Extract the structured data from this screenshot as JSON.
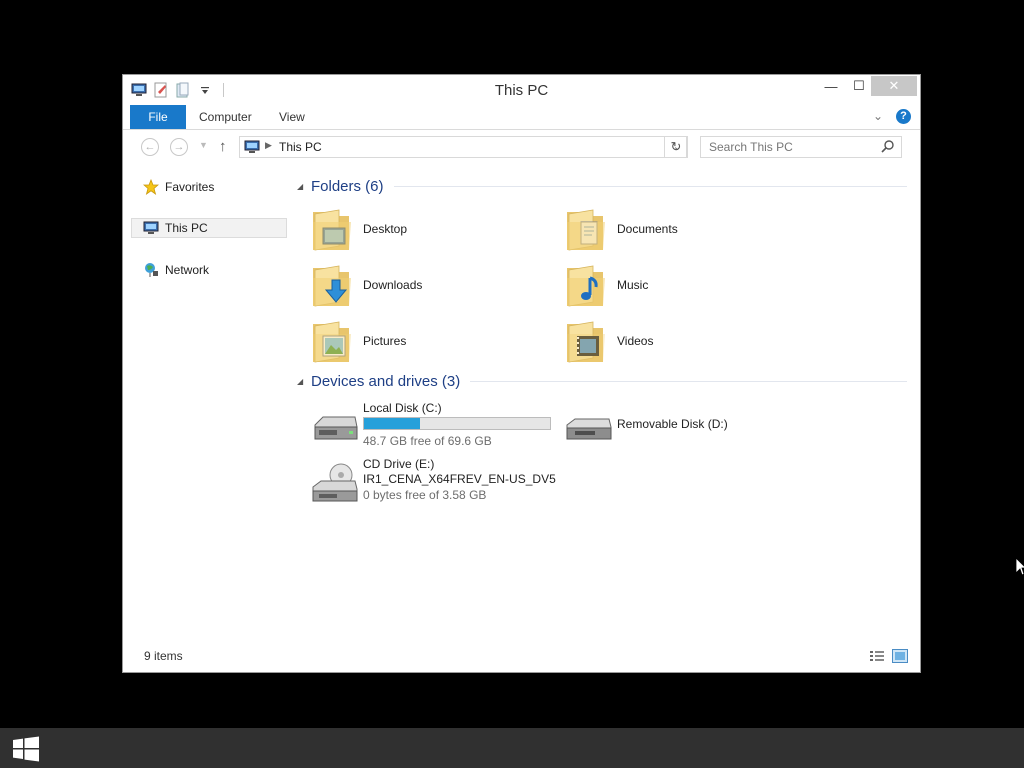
{
  "window": {
    "title": "This PC",
    "minimize_glyph": "—",
    "maximize_glyph": "☐",
    "close_glyph": "✕"
  },
  "ribbon": {
    "tabs": [
      {
        "label": "File"
      },
      {
        "label": "Computer"
      },
      {
        "label": "View"
      }
    ],
    "expand_glyph": "⌄",
    "help_glyph": "?"
  },
  "navigation": {
    "back_glyph": "←",
    "forward_glyph": "→",
    "recent_glyph": "▼",
    "up_glyph": "↑",
    "address_path": "This PC",
    "address_dropdown_glyph": "⌄",
    "refresh_glyph": "↻",
    "search_placeholder": "Search This PC"
  },
  "nav_pane": {
    "items": [
      {
        "label": "Favorites",
        "icon": "star-icon"
      },
      {
        "label": "This PC",
        "icon": "computer-icon",
        "selected": true
      },
      {
        "label": "Network",
        "icon": "network-icon"
      }
    ]
  },
  "content": {
    "folders_header": "Folders (6)",
    "folders": [
      {
        "name": "Desktop",
        "overlay": "desktop"
      },
      {
        "name": "Documents",
        "overlay": "documents"
      },
      {
        "name": "Downloads",
        "overlay": "downloads"
      },
      {
        "name": "Music",
        "overlay": "music"
      },
      {
        "name": "Pictures",
        "overlay": "pictures"
      },
      {
        "name": "Videos",
        "overlay": "videos"
      }
    ],
    "devices_header": "Devices and drives (3)",
    "drives": [
      {
        "name": "Local Disk (C:)",
        "free_text": "48.7 GB free of 69.6 GB",
        "used_fraction": 0.3
      },
      {
        "name": "Removable Disk (D:)"
      },
      {
        "name": "CD Drive (E:)",
        "volume_label": "IR1_CENA_X64FREV_EN-US_DV5",
        "free_text": "0 bytes free of 3.58 GB"
      }
    ]
  },
  "status": {
    "items_text": "9 items"
  },
  "colors": {
    "accent": "#1979ca",
    "group_header": "#1e3f85",
    "capacity_bar": "#26a0da"
  }
}
